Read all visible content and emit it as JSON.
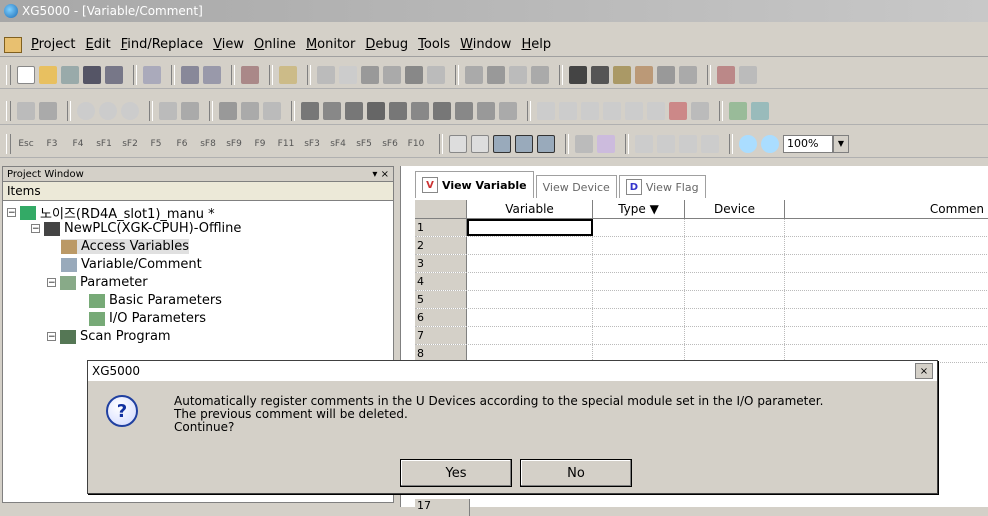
{
  "window": {
    "title": "XG5000 - [Variable/Comment]"
  },
  "menu": [
    {
      "label": "Project",
      "u": "P"
    },
    {
      "label": "Edit",
      "u": "E"
    },
    {
      "label": "Find/Replace",
      "u": "F"
    },
    {
      "label": "View",
      "u": "V"
    },
    {
      "label": "Online",
      "u": "O"
    },
    {
      "label": "Monitor",
      "u": "M"
    },
    {
      "label": "Debug",
      "u": "D"
    },
    {
      "label": "Tools",
      "u": "T"
    },
    {
      "label": "Window",
      "u": "W"
    },
    {
      "label": "Help",
      "u": "H"
    }
  ],
  "toolbar": {
    "zoom_value": "100%"
  },
  "function_keys": [
    "Esc",
    "F3",
    "F4",
    "sF1",
    "sF2",
    "F5",
    "F6",
    "sF8",
    "sF9",
    "F9",
    "F11",
    "sF3",
    "sF4",
    "sF5",
    "sF6",
    "F10"
  ],
  "project_window": {
    "title": "Project Window",
    "pin": "▾ ×",
    "items_header": "Items",
    "tree": {
      "root": "노이즈(RD4A_slot1)_manu *",
      "plc": "NewPLC(XGK-CPUH)-Offline",
      "access_variables": "Access Variables",
      "variable_comment": "Variable/Comment",
      "parameter": "Parameter",
      "basic_parameters": "Basic Parameters",
      "io_parameters": "I/O Parameters",
      "scan_program": "Scan Program"
    }
  },
  "variable_window": {
    "tabs": [
      {
        "badge": "V",
        "label": "View Variable"
      },
      {
        "label": "View Device"
      },
      {
        "badge": "D",
        "label": "View Flag"
      }
    ],
    "columns": [
      "Variable",
      "Type",
      "Device",
      "Commen"
    ],
    "type_sort_icon": "▼",
    "rows": [
      "1",
      "2",
      "3",
      "4",
      "5",
      "6",
      "7",
      "8"
    ],
    "last_row": "17"
  },
  "dialog": {
    "title": "XG5000",
    "close": "×",
    "message_line1": "Automatically register comments in the U Devices according to the special module set in the I/O parameter.",
    "message_line2": "The previous comment will be deleted.",
    "message_line3": "Continue?",
    "yes_label": "Yes",
    "no_label": "No"
  }
}
